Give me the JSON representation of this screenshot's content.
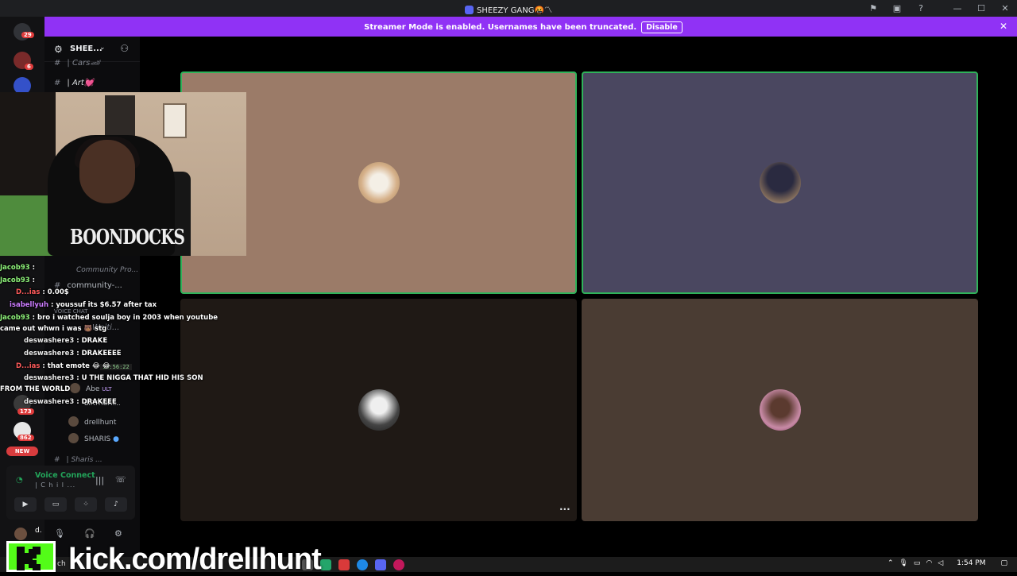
{
  "window": {
    "title": "SHEEZY GANG🤬〽",
    "icons": [
      "flag-icon",
      "inbox-icon",
      "help-icon",
      "minimize-icon",
      "maximize-icon",
      "close-icon"
    ]
  },
  "banner": {
    "message": "Streamer Mode is enabled. Usernames have been truncated.",
    "button_label": "Disable",
    "close_glyph": "✕"
  },
  "servers": [
    {
      "badge": "29"
    },
    {
      "badge": "6"
    },
    {
      "badge": ""
    },
    {
      "badge": "173"
    },
    {
      "badge": "862"
    }
  ],
  "new_label": "NEW",
  "server_header": {
    "name": "SHEE...",
    "chevron": "⌄"
  },
  "channels": {
    "cars": "| Cars🏎",
    "art": "| Art💓",
    "community_pro": "Community Pro...",
    "community": "community-...",
    "voice_chat_label": "VOICE CHAT",
    "waiting": "Waiti...",
    "birthday": "BIRTHDAY...",
    "sharis_channel": "| Sharis ..."
  },
  "members": {
    "abe": "Abe",
    "abe_tag": "ULT",
    "drellhunt": "drellhunt",
    "sharis": "SHARIS",
    "live_time": "10:56:22"
  },
  "voice": {
    "status": "Voice Connect",
    "channel": "| C h i l ...",
    "user_short": "d."
  },
  "chat": [
    {
      "user": "Jacob93",
      "text": ":"
    },
    {
      "user": "Jacob93",
      "text": ":"
    },
    {
      "user": "D...ias",
      "text": ": 0.00$"
    },
    {
      "user": "isabellyuh",
      "text": ": youssuf its $6.57 after tax"
    },
    {
      "user": "Jacob93",
      "text": ": bro i watched soulja boy in 2003 when youtube"
    },
    {
      "user": "",
      "text": "came out whwn i was 🐻 stg"
    },
    {
      "user": "deswashere3",
      "text": ": DRAKE"
    },
    {
      "user": "deswashere3",
      "text": ": DRAKEEEE"
    },
    {
      "user": "D...ias",
      "text": ": that emote 😂 😂"
    },
    {
      "user": "deswashere3",
      "text": ": U THE NIGGA THAT HID HIS SON"
    },
    {
      "user": "",
      "text": "FROM THE WORLD"
    },
    {
      "user": "deswashere3",
      "text": ": DRAKEEE"
    }
  ],
  "webcam_shirt_text": "BOONDOCKS",
  "stage": {
    "more_glyph": "···"
  },
  "taskbar": {
    "clock": "1:54 PM",
    "search_fragment": "ch"
  },
  "watermark": {
    "url": "kick.com/drellhunt"
  },
  "colors": {
    "speaking_border": "#2fb35a",
    "banner": "#9032f5",
    "kick_green": "#53fc18"
  }
}
